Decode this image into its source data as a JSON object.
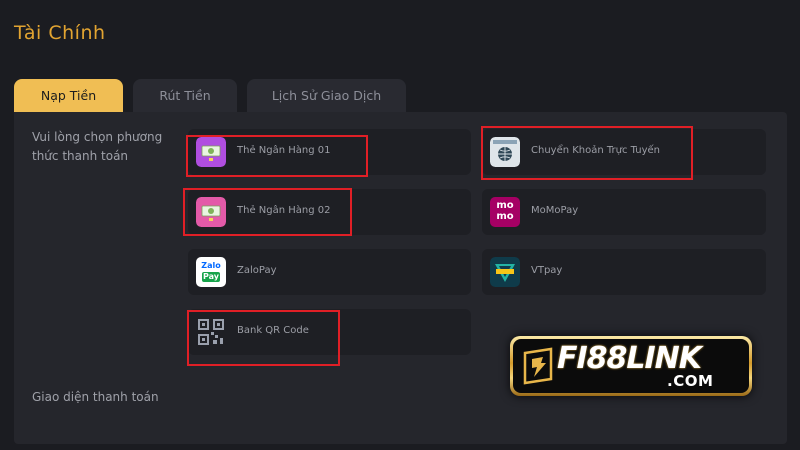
{
  "page": {
    "title": "Tài Chính"
  },
  "tabs": [
    {
      "label": "Nạp Tiền",
      "active": true
    },
    {
      "label": "Rút Tiền",
      "active": false
    },
    {
      "label": "Lịch Sử Giao Dịch",
      "active": false
    }
  ],
  "deposit": {
    "choose_label": "Vui lòng chọn phương thức thanh toán",
    "interface_label": "Giao diện thanh toán",
    "methods": [
      {
        "label": "Thẻ Ngân Hàng 01",
        "icon": "bank-card-icon",
        "highlighted": true
      },
      {
        "label": "Chuyển Khoản Trực Tuyến",
        "icon": "online-transfer-icon",
        "highlighted": true
      },
      {
        "label": "Thẻ Ngân Hàng 02",
        "icon": "bank-card-icon",
        "highlighted": true
      },
      {
        "label": "MoMoPay",
        "icon": "momo-icon",
        "highlighted": false
      },
      {
        "label": "ZaloPay",
        "icon": "zalopay-icon",
        "highlighted": false
      },
      {
        "label": "VTpay",
        "icon": "vtpay-icon",
        "highlighted": false
      },
      {
        "label": "Bank QR Code",
        "icon": "qr-code-icon",
        "highlighted": true
      }
    ]
  },
  "icon_text": {
    "momo_top": "mo",
    "momo_bottom": "mo",
    "zalo_top": "Zalo",
    "zalo_bottom": "Pay"
  },
  "watermark": {
    "main": "FI88LINK",
    "sub": ".COM"
  },
  "colors": {
    "accent": "#f0be54",
    "title": "#e2a431",
    "highlight": "#e01f26",
    "momo": "#a50064",
    "zalo": "#0068ff"
  }
}
